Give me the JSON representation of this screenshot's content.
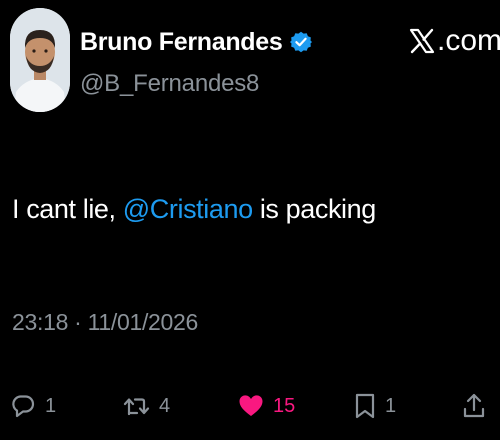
{
  "author": {
    "display_name": "Bruno Fernandes",
    "handle": "@B_Fernandes8",
    "verified": true,
    "verified_color": "#1d9bf0"
  },
  "source": {
    "logo_icon": "x-logo-icon",
    "label": ".com"
  },
  "tweet": {
    "text_before": "I cant lie, ",
    "mention": "@Cristiano",
    "text_after": " is packing",
    "timestamp": "23:18 · 11/01/2026"
  },
  "actions": {
    "reply": {
      "icon": "reply-icon",
      "count": "1"
    },
    "retweet": {
      "icon": "retweet-icon",
      "count": "4"
    },
    "like": {
      "icon": "heart-icon",
      "count": "15",
      "liked": true,
      "color": "#f91880"
    },
    "bookmark": {
      "icon": "bookmark-icon",
      "count": "1"
    },
    "share": {
      "icon": "share-icon"
    }
  },
  "colors": {
    "background": "#000000",
    "text": "#ffffff",
    "secondary": "#8b9299",
    "mention": "#1d9bf0"
  }
}
